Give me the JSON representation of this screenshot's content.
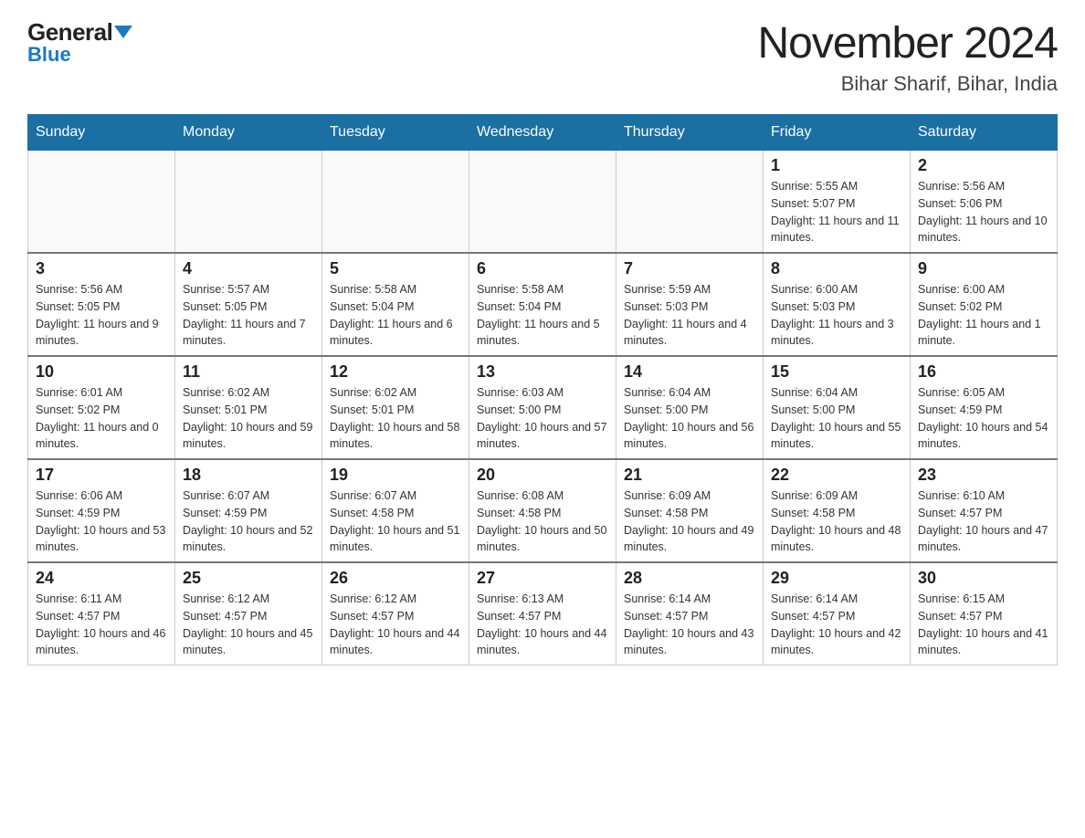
{
  "logo": {
    "general": "General",
    "blue": "Blue"
  },
  "header": {
    "month_year": "November 2024",
    "location": "Bihar Sharif, Bihar, India"
  },
  "weekdays": [
    "Sunday",
    "Monday",
    "Tuesday",
    "Wednesday",
    "Thursday",
    "Friday",
    "Saturday"
  ],
  "weeks": [
    [
      {
        "day": "",
        "info": ""
      },
      {
        "day": "",
        "info": ""
      },
      {
        "day": "",
        "info": ""
      },
      {
        "day": "",
        "info": ""
      },
      {
        "day": "",
        "info": ""
      },
      {
        "day": "1",
        "info": "Sunrise: 5:55 AM\nSunset: 5:07 PM\nDaylight: 11 hours and 11 minutes."
      },
      {
        "day": "2",
        "info": "Sunrise: 5:56 AM\nSunset: 5:06 PM\nDaylight: 11 hours and 10 minutes."
      }
    ],
    [
      {
        "day": "3",
        "info": "Sunrise: 5:56 AM\nSunset: 5:05 PM\nDaylight: 11 hours and 9 minutes."
      },
      {
        "day": "4",
        "info": "Sunrise: 5:57 AM\nSunset: 5:05 PM\nDaylight: 11 hours and 7 minutes."
      },
      {
        "day": "5",
        "info": "Sunrise: 5:58 AM\nSunset: 5:04 PM\nDaylight: 11 hours and 6 minutes."
      },
      {
        "day": "6",
        "info": "Sunrise: 5:58 AM\nSunset: 5:04 PM\nDaylight: 11 hours and 5 minutes."
      },
      {
        "day": "7",
        "info": "Sunrise: 5:59 AM\nSunset: 5:03 PM\nDaylight: 11 hours and 4 minutes."
      },
      {
        "day": "8",
        "info": "Sunrise: 6:00 AM\nSunset: 5:03 PM\nDaylight: 11 hours and 3 minutes."
      },
      {
        "day": "9",
        "info": "Sunrise: 6:00 AM\nSunset: 5:02 PM\nDaylight: 11 hours and 1 minute."
      }
    ],
    [
      {
        "day": "10",
        "info": "Sunrise: 6:01 AM\nSunset: 5:02 PM\nDaylight: 11 hours and 0 minutes."
      },
      {
        "day": "11",
        "info": "Sunrise: 6:02 AM\nSunset: 5:01 PM\nDaylight: 10 hours and 59 minutes."
      },
      {
        "day": "12",
        "info": "Sunrise: 6:02 AM\nSunset: 5:01 PM\nDaylight: 10 hours and 58 minutes."
      },
      {
        "day": "13",
        "info": "Sunrise: 6:03 AM\nSunset: 5:00 PM\nDaylight: 10 hours and 57 minutes."
      },
      {
        "day": "14",
        "info": "Sunrise: 6:04 AM\nSunset: 5:00 PM\nDaylight: 10 hours and 56 minutes."
      },
      {
        "day": "15",
        "info": "Sunrise: 6:04 AM\nSunset: 5:00 PM\nDaylight: 10 hours and 55 minutes."
      },
      {
        "day": "16",
        "info": "Sunrise: 6:05 AM\nSunset: 4:59 PM\nDaylight: 10 hours and 54 minutes."
      }
    ],
    [
      {
        "day": "17",
        "info": "Sunrise: 6:06 AM\nSunset: 4:59 PM\nDaylight: 10 hours and 53 minutes."
      },
      {
        "day": "18",
        "info": "Sunrise: 6:07 AM\nSunset: 4:59 PM\nDaylight: 10 hours and 52 minutes."
      },
      {
        "day": "19",
        "info": "Sunrise: 6:07 AM\nSunset: 4:58 PM\nDaylight: 10 hours and 51 minutes."
      },
      {
        "day": "20",
        "info": "Sunrise: 6:08 AM\nSunset: 4:58 PM\nDaylight: 10 hours and 50 minutes."
      },
      {
        "day": "21",
        "info": "Sunrise: 6:09 AM\nSunset: 4:58 PM\nDaylight: 10 hours and 49 minutes."
      },
      {
        "day": "22",
        "info": "Sunrise: 6:09 AM\nSunset: 4:58 PM\nDaylight: 10 hours and 48 minutes."
      },
      {
        "day": "23",
        "info": "Sunrise: 6:10 AM\nSunset: 4:57 PM\nDaylight: 10 hours and 47 minutes."
      }
    ],
    [
      {
        "day": "24",
        "info": "Sunrise: 6:11 AM\nSunset: 4:57 PM\nDaylight: 10 hours and 46 minutes."
      },
      {
        "day": "25",
        "info": "Sunrise: 6:12 AM\nSunset: 4:57 PM\nDaylight: 10 hours and 45 minutes."
      },
      {
        "day": "26",
        "info": "Sunrise: 6:12 AM\nSunset: 4:57 PM\nDaylight: 10 hours and 44 minutes."
      },
      {
        "day": "27",
        "info": "Sunrise: 6:13 AM\nSunset: 4:57 PM\nDaylight: 10 hours and 44 minutes."
      },
      {
        "day": "28",
        "info": "Sunrise: 6:14 AM\nSunset: 4:57 PM\nDaylight: 10 hours and 43 minutes."
      },
      {
        "day": "29",
        "info": "Sunrise: 6:14 AM\nSunset: 4:57 PM\nDaylight: 10 hours and 42 minutes."
      },
      {
        "day": "30",
        "info": "Sunrise: 6:15 AM\nSunset: 4:57 PM\nDaylight: 10 hours and 41 minutes."
      }
    ]
  ]
}
